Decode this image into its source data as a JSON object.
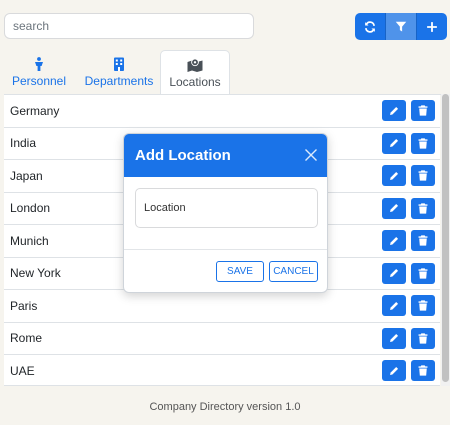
{
  "search": {
    "placeholder": "search"
  },
  "toolbar": {
    "refresh_icon": "refresh-icon",
    "filter_icon": "filter-icon",
    "add_icon": "plus-icon"
  },
  "tabs": [
    {
      "label": "Personnel",
      "icon": "person-icon",
      "active": false
    },
    {
      "label": "Departments",
      "icon": "building-icon",
      "active": false
    },
    {
      "label": "Locations",
      "icon": "map-icon",
      "active": true
    }
  ],
  "locations": [
    "Germany",
    "India",
    "Japan",
    "London",
    "Munich",
    "New York",
    "Paris",
    "Rome",
    "UAE"
  ],
  "modal": {
    "title": "Add Location",
    "field_placeholder": "Location",
    "save_label": "SAVE",
    "cancel_label": "CANCEL"
  },
  "footer": {
    "text": "Company Directory version 1.0"
  },
  "colors": {
    "accent": "#1a73e8",
    "background": "#f6f4ee"
  }
}
